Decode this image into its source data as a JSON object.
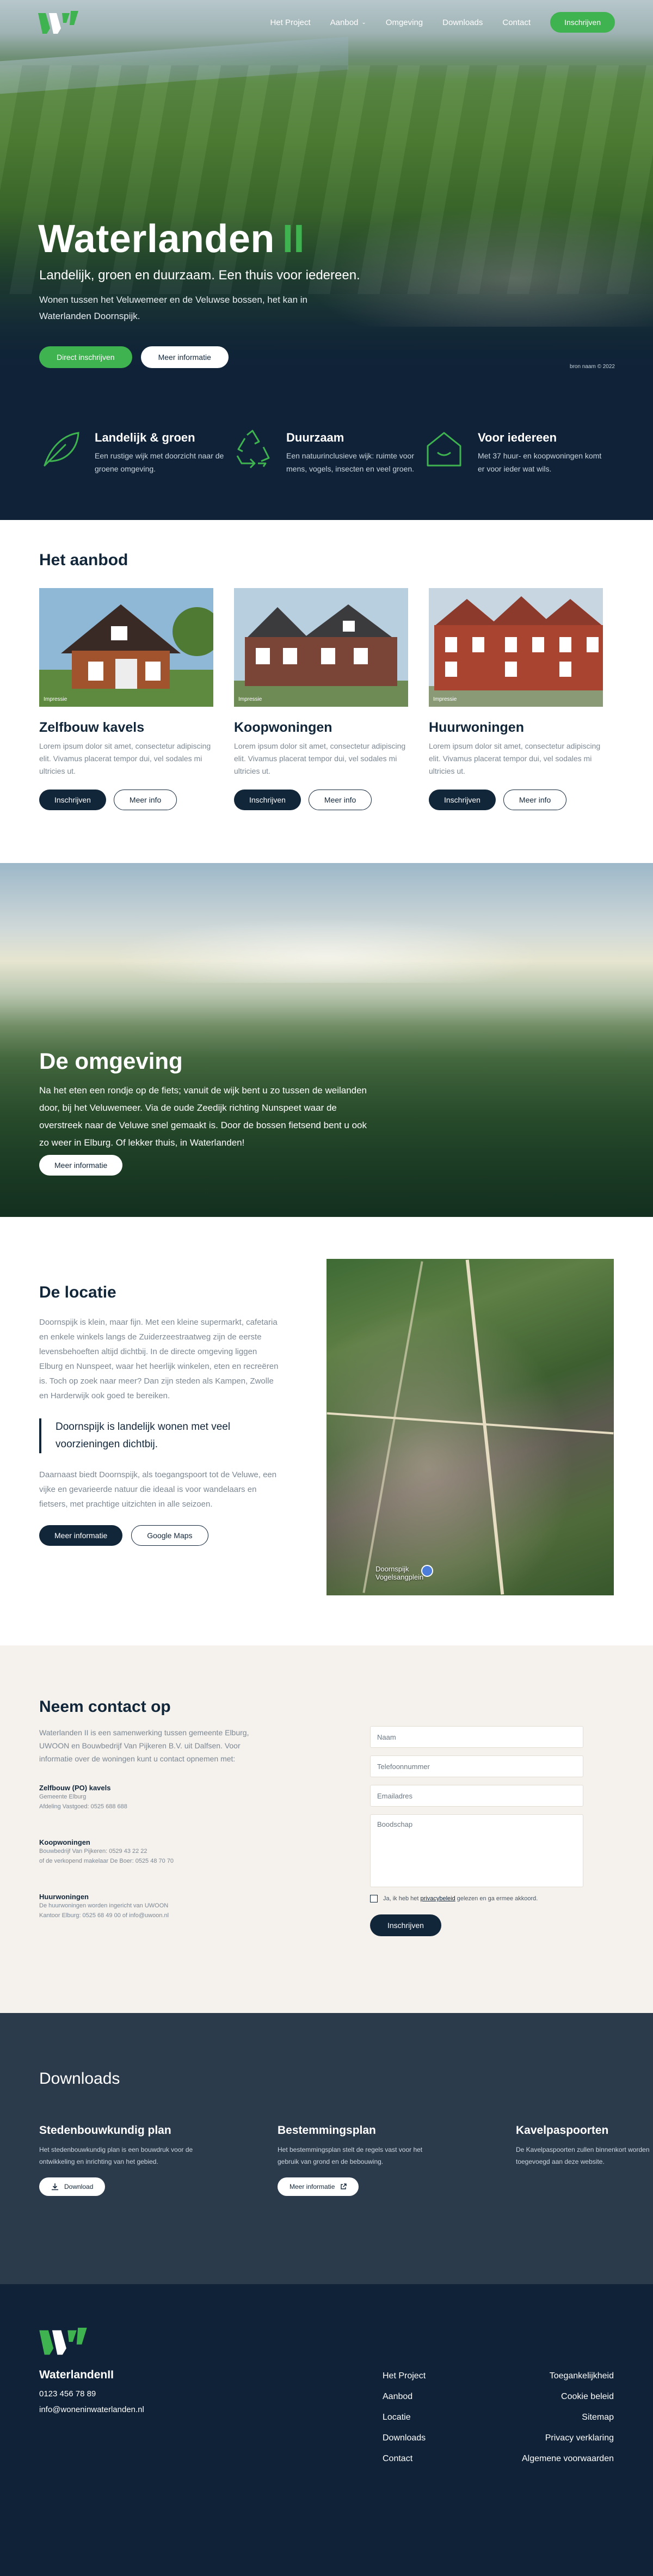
{
  "nav": {
    "items": [
      {
        "label": "Het Project"
      },
      {
        "label": "Aanbod"
      },
      {
        "label": "Omgeving"
      },
      {
        "label": "Downloads"
      },
      {
        "label": "Contact"
      }
    ],
    "cta": "Inschrijven"
  },
  "hero": {
    "title": "Waterlanden",
    "title_suffix": "II",
    "subtitle": "Landelijk, groen en duurzaam. Een thuis voor iedereen.",
    "description": "Wonen tussen het Veluwemeer en de Veluwse bossen, het kan in Waterlanden Doornspijk.",
    "primary_button": "Direct inschrijven",
    "secondary_button": "Meer informatie",
    "credit": "bron naam © 2022"
  },
  "features": [
    {
      "icon": "leaf-icon",
      "title": "Landelijk & groen",
      "text": "Een rustige wijk met doorzicht naar de groene omgeving."
    },
    {
      "icon": "recycle-icon",
      "title": "Duurzaam",
      "text": "Een natuurinclusieve wijk: ruimte voor mens, vogels, insecten en veel groen."
    },
    {
      "icon": "house-icon",
      "title": "Voor iedereen",
      "text": "Met 37 huur- en koopwoningen komt er voor ieder wat wils."
    }
  ],
  "aanbod": {
    "title": "Het aanbod",
    "cards": [
      {
        "title": "Zelfbouw kavels",
        "tag": "Impressie",
        "text": "Lorem ipsum dolor sit amet, consectetur adipiscing elit. Vivamus placerat tempor dui, vel sodales mi ultricies ut.",
        "btn_primary": "Inschrijven",
        "btn_secondary": "Meer info"
      },
      {
        "title": "Koopwoningen",
        "tag": "Impressie",
        "text": "Lorem ipsum dolor sit amet, consectetur adipiscing elit. Vivamus placerat tempor dui, vel sodales mi ultricies ut.",
        "btn_primary": "Inschrijven",
        "btn_secondary": "Meer info"
      },
      {
        "title": "Huurwoningen",
        "tag": "Impressie",
        "text": "Lorem ipsum dolor sit amet, consectetur adipiscing elit. Vivamus placerat tempor dui, vel sodales mi ultricies ut.",
        "btn_primary": "Inschrijven",
        "btn_secondary": "Meer info"
      }
    ]
  },
  "omgeving": {
    "title": "De omgeving",
    "text": "Na het eten een rondje op de fiets; vanuit de wijk bent u zo tussen de weilanden door, bij het Veluwemeer. Via de oude Zeedijk richting Nunspeet waar de overstreek naar de Veluwe snel gemaakt is. Door de bossen fietsend bent u ook zo weer in Elburg. Of lekker thuis, in Waterlanden!",
    "button": "Meer informatie"
  },
  "locatie": {
    "title": "De locatie",
    "text1": "Doornspijk is klein, maar fijn. Met een kleine supermarkt, cafetaria en enkele winkels langs de Zuiderzeestraatweg zijn de eerste levensbehoeften altijd dichtbij. In de directe omgeving liggen Elburg en Nunspeet, waar het heerlijk winkelen, eten en recreëren is. Toch op zoek naar meer? Dan zijn steden als Kampen, Zwolle en Harderwijk ook goed te bereiken.",
    "quote": "Doornspijk is landelijk wonen met veel voorzieningen dichtbij.",
    "text2": "Daarnaast biedt Doornspijk, als toegangspoort tot de Veluwe, een vijke en gevarieerde natuur die ideaal is voor wandelaars en fietsers, met prachtige uitzichten in alle seizoen.",
    "btn_primary": "Meer informatie",
    "btn_secondary": "Google Maps",
    "map_label": "Doornspijk\nVogelsangplein"
  },
  "contact": {
    "title": "Neem contact op",
    "intro": "Waterlanden II is een samenwerking tussen gemeente Elburg, UWOON en Bouwbedrijf Van Pijkeren B.V. uit Dalfsen. Voor informatie over de woningen kunt u contact opnemen met:",
    "blocks": [
      {
        "head": "Zelfbouw (PO) kavels",
        "lines": [
          "Gemeente Elburg",
          "Afdeling Vastgoed: 0525 688 688"
        ]
      },
      {
        "head": "Koopwoningen",
        "lines": [
          "Bouwbedrijf Van Pijkeren: 0529 43 22 22",
          "of de verkopend makelaar De Boer: 0525 48 70 70"
        ]
      },
      {
        "head": "Huurwoningen",
        "lines": [
          "De huurwoningen worden ingericht van UWOON",
          "Kantoor Elburg: 0525 68 49 00 of info@uwoon.nl"
        ]
      }
    ],
    "form": {
      "name_placeholder": "Naam",
      "phone_placeholder": "Telefoonnummer",
      "email_placeholder": "Emailadres",
      "message_placeholder": "Boodschap",
      "consent_prefix": "Ja, ik heb het ",
      "consent_link": "privacybeleid",
      "consent_suffix": " gelezen en ga ermee akkoord.",
      "submit": "Inschrijven"
    }
  },
  "downloads": {
    "title": "Downloads",
    "items": [
      {
        "title": "Stedenbouwkundig plan",
        "text": "Het stedenbouwkundig plan is een bouwdruk voor de ontwikkeling en inrichting van het gebied.",
        "button": "Download",
        "icon": "download-icon"
      },
      {
        "title": "Bestemmingsplan",
        "text": "Het bestemmingsplan stelt de regels vast voor het gebruik van grond en de bebouwing.",
        "button": "Meer informatie",
        "icon": "external-link-icon"
      },
      {
        "title": "Kavelpaspoorten",
        "text": "De Kavelpaspoorten zullen binnenkort worden toegevoegd aan deze website."
      }
    ]
  },
  "footer": {
    "brand": "WaterlandenII",
    "phone": "0123 456 78 89",
    "email": "info@woneninwaterlanden.nl",
    "links": [
      "Het Project",
      "Aanbod",
      "Locatie",
      "Downloads",
      "Contact"
    ],
    "legal_links": [
      "Toegankelijkheid",
      "Cookie beleid",
      "Sitemap",
      "Privacy verklaring",
      "Algemene voorwaarden"
    ]
  },
  "colors": {
    "navy": "#0f2238",
    "green": "#3fb34f",
    "downloads_bg": "#2b3b4c",
    "contact_bg": "#f5f1ec"
  }
}
